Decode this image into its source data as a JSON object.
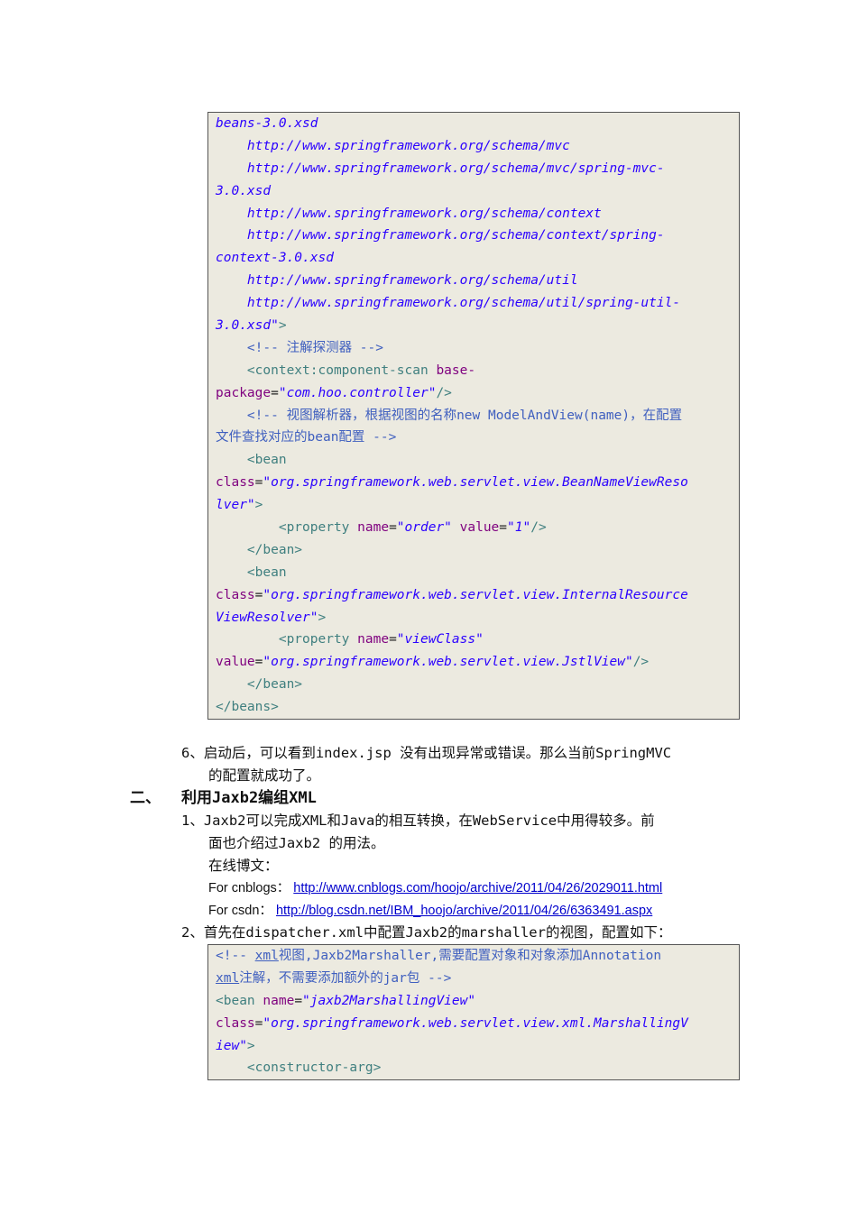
{
  "code_block_1": [
    [
      [
        "s",
        "beans-3.0.xsd"
      ]
    ],
    [
      [
        "s",
        "    http://www.springframework.org/schema/mvc"
      ]
    ],
    [
      [
        "s",
        "    http://www.springframework.org/schema/mvc/spring-mvc-"
      ]
    ],
    [
      [
        "s",
        "3.0.xsd"
      ]
    ],
    [
      [
        "s",
        "    http://www.springframework.org/schema/context"
      ]
    ],
    [
      [
        "s",
        "    http://www.springframework.org/schema/context/spring-"
      ]
    ],
    [
      [
        "s",
        "context-3.0.xsd"
      ]
    ],
    [
      [
        "s",
        "    http://www.springframework.org/schema/util"
      ]
    ],
    [
      [
        "s",
        "    http://www.springframework.org/schema/util/spring-util-"
      ]
    ],
    [
      [
        "s",
        "3.0.xsd\""
      ],
      [
        "t",
        ">"
      ]
    ],
    [
      [
        "c",
        "    <!-- 注解探测器 -->"
      ]
    ],
    [
      [
        "t",
        "    <context:component-scan "
      ],
      [
        "a",
        "base-"
      ]
    ],
    [
      [
        "a",
        "package"
      ],
      [
        "p",
        "="
      ],
      [
        "s",
        "\"com.hoo.controller\""
      ],
      [
        "t",
        "/>"
      ]
    ],
    [
      [
        "c",
        "    <!-- 视图解析器，根据视图的名称new ModelAndView(name)，在配置"
      ]
    ],
    [
      [
        "c",
        "文件查找对应的bean配置 -->"
      ]
    ],
    [
      [
        "t",
        "    <bean"
      ]
    ],
    [
      [
        "a",
        "class"
      ],
      [
        "p",
        "="
      ],
      [
        "s",
        "\"org.springframework.web.servlet.view.BeanNameViewReso"
      ]
    ],
    [
      [
        "s",
        "lver\""
      ],
      [
        "t",
        ">"
      ]
    ],
    [
      [
        "t",
        "        <property "
      ],
      [
        "a",
        "name"
      ],
      [
        "p",
        "="
      ],
      [
        "s",
        "\"order\" "
      ],
      [
        "a",
        "value"
      ],
      [
        "p",
        "="
      ],
      [
        "s",
        "\"1\""
      ],
      [
        "t",
        "/>"
      ]
    ],
    [
      [
        "t",
        "    </bean>"
      ]
    ],
    [
      [
        "t",
        "    <bean"
      ]
    ],
    [
      [
        "a",
        "class"
      ],
      [
        "p",
        "="
      ],
      [
        "s",
        "\"org.springframework.web.servlet.view.InternalResource"
      ]
    ],
    [
      [
        "s",
        "ViewResolver\""
      ],
      [
        "t",
        ">"
      ]
    ],
    [
      [
        "t",
        "        <property "
      ],
      [
        "a",
        "name"
      ],
      [
        "p",
        "="
      ],
      [
        "s",
        "\"viewClass\""
      ]
    ],
    [
      [
        "a",
        "value"
      ],
      [
        "p",
        "="
      ],
      [
        "s",
        "\"org.springframework.web.servlet.view.JstlView\""
      ],
      [
        "t",
        "/>"
      ]
    ],
    [
      [
        "t",
        "    </bean>"
      ]
    ],
    [
      [
        "t",
        "</beans>"
      ]
    ]
  ],
  "step6": {
    "line1": "6、启动后，可以看到index.jsp 没有出现异常或错误。那么当前SpringMVC",
    "line2": "的配置就成功了。"
  },
  "section2": {
    "number": "二、",
    "title": "利用Jaxb2编组XML"
  },
  "step1": {
    "line1": "1、Jaxb2可以完成XML和Java的相互转换，在WebService中用得较多。前",
    "line2": "面也介绍过Jaxb2 的用法。",
    "online": "在线博文：",
    "cnblogs_label": "For cnblogs：",
    "cnblogs_url": "http://www.cnblogs.com/hoojo/archive/2011/04/26/2029011.html",
    "csdn_label": "For csdn：",
    "csdn_url": "http://blog.csdn.net/IBM_hoojo/archive/2011/04/26/6363491.aspx"
  },
  "step2": {
    "line1": "2、首先在dispatcher.xml中配置Jaxb2的marshaller的视图，配置如下："
  },
  "code_block_2": [
    [
      [
        "c",
        "<!-- "
      ],
      [
        "u",
        "xml"
      ],
      [
        "c",
        "视图,Jaxb2Marshaller,需要配置对象和对象添加Annotation"
      ]
    ],
    [
      [
        "u",
        "xml"
      ],
      [
        "c",
        "注解，不需要添加额外的jar包 -->"
      ]
    ],
    [
      [
        "t",
        "<bean "
      ],
      [
        "a",
        "name"
      ],
      [
        "p",
        "="
      ],
      [
        "s",
        "\"jaxb2MarshallingView\""
      ]
    ],
    [
      [
        "a",
        "class"
      ],
      [
        "p",
        "="
      ],
      [
        "s",
        "\"org.springframework.web.servlet.view.xml.MarshallingV"
      ]
    ],
    [
      [
        "s",
        "iew\""
      ],
      [
        "t",
        ">"
      ]
    ],
    [
      [
        "t",
        "    <constructor-arg>"
      ]
    ]
  ],
  "colors": {
    "code_bg": "#eceae0",
    "tag": "#3f7f7f",
    "attr": "#7f007f",
    "string": "#2a00ff",
    "comment": "#3f5fbf"
  }
}
